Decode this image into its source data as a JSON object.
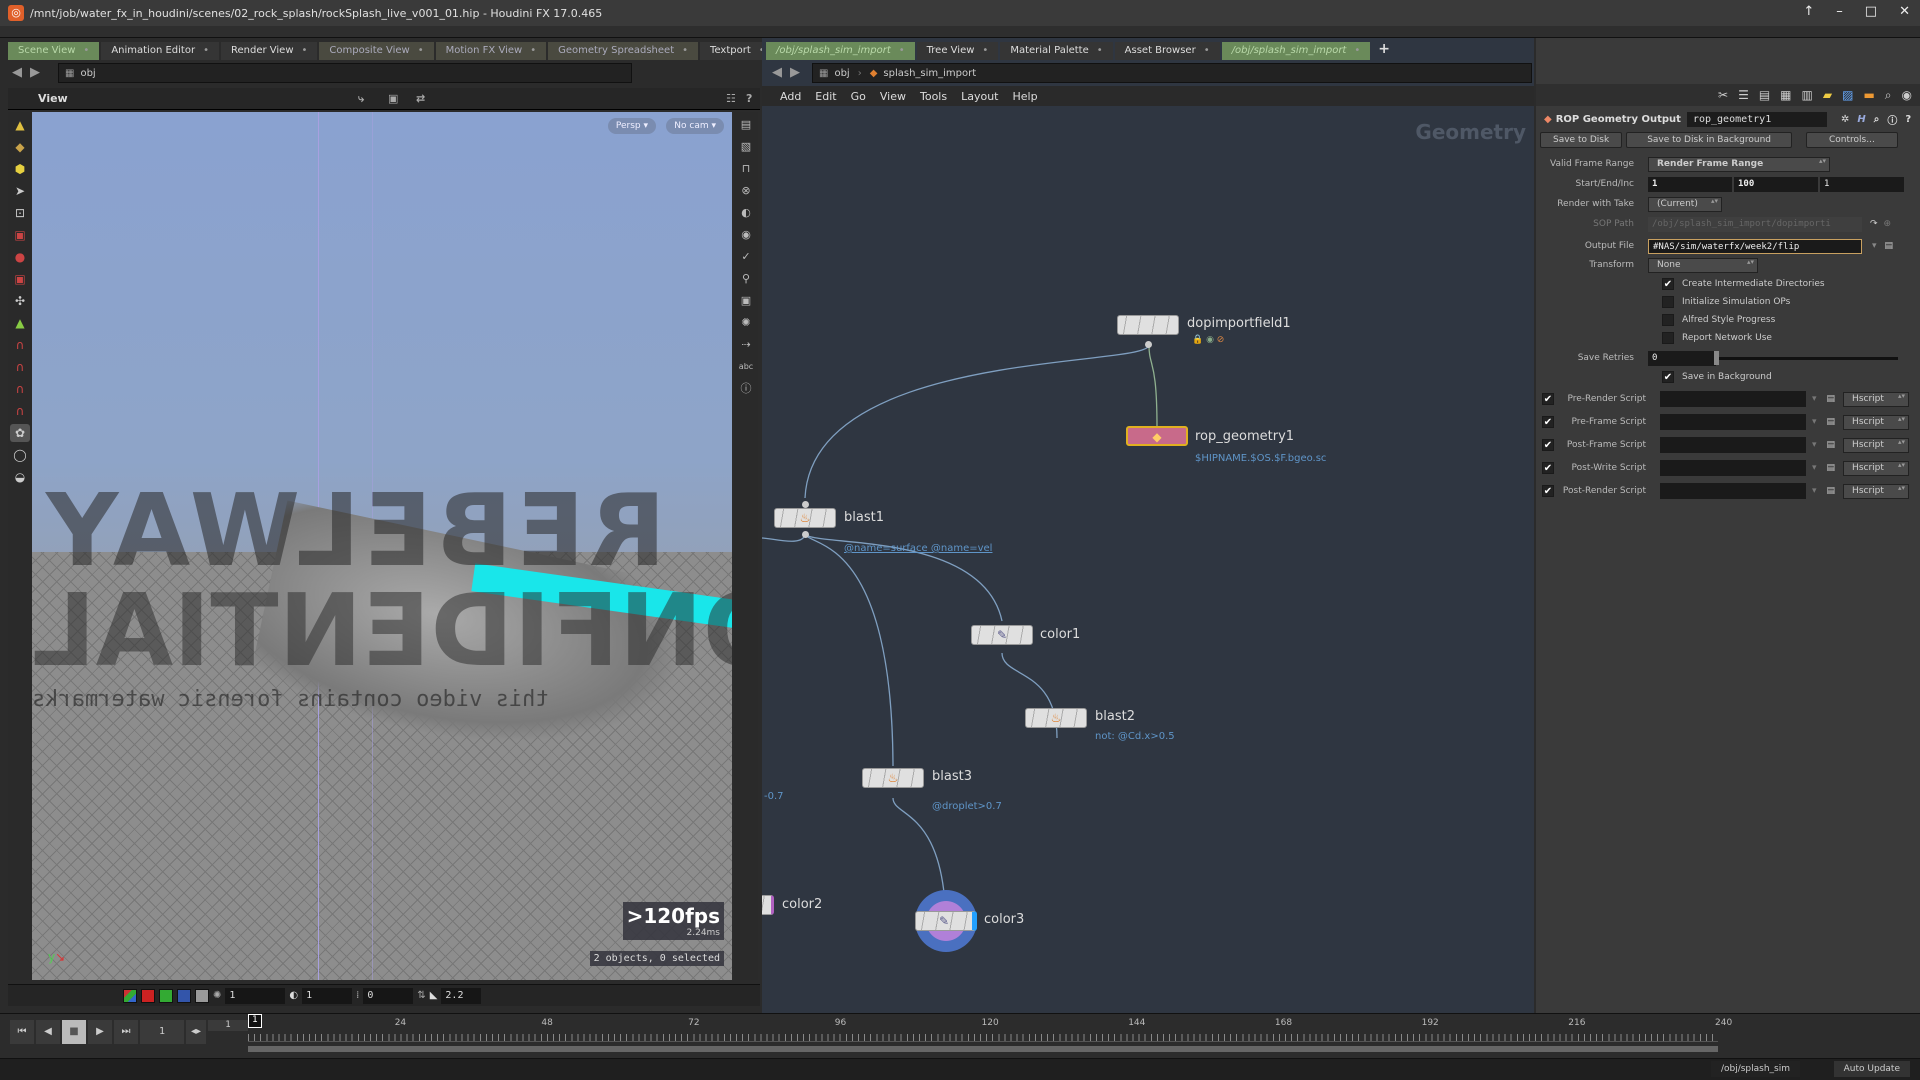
{
  "window": {
    "title": "/mnt/job/water_fx_in_houdini/scenes/02_rock_splash/rockSplash_live_v001_01.hip - Houdini FX 17.0.465",
    "controls": [
      "up-arrow",
      "minimize",
      "maximize",
      "close"
    ]
  },
  "left_pane": {
    "tabs": [
      {
        "label": "Scene View",
        "active": true
      },
      {
        "label": "Animation Editor"
      },
      {
        "label": "Render View"
      },
      {
        "label": "Composite View"
      },
      {
        "label": "Motion FX View"
      },
      {
        "label": "Geometry Spreadsheet"
      },
      {
        "label": "Textport"
      }
    ],
    "path": "obj",
    "view_title": "View",
    "camera_menu": "Persp",
    "cam_menu": "No cam",
    "watermark_line1": "REBELWAY",
    "watermark_line2": "CONFIDENTIAL",
    "watermark_line3": "this video contains forensic watermarks",
    "fps": ">120fps",
    "frame_time": "2.24ms",
    "selection_info": "2 objects, 0 selected",
    "display_bar": {
      "point_size": "1",
      "opacity": "1",
      "offset": "0",
      "gamma": "2.2"
    }
  },
  "network_pane": {
    "tabs": [
      {
        "label": "/obj/splash_sim_import",
        "active": true
      },
      {
        "label": "Tree View"
      },
      {
        "label": "Material Palette"
      },
      {
        "label": "Asset Browser"
      },
      {
        "label": "/obj/splash_sim_import",
        "active": true
      }
    ],
    "breadcrumb": [
      "obj",
      "splash_sim_import"
    ],
    "menu": [
      "Add",
      "Edit",
      "Go",
      "View",
      "Tools",
      "Layout",
      "Help"
    ],
    "context_label": "Geometry",
    "nodes": [
      {
        "name": "dopimportfield1",
        "comment": ""
      },
      {
        "name": "rop_geometry1",
        "comment": "$HIPNAME.$OS.$F.bgeo.sc"
      },
      {
        "name": "blast1",
        "comment": "@name=surface @name=vel"
      },
      {
        "name": "color1",
        "comment": ""
      },
      {
        "name": "blast2",
        "comment": "not: @Cd.x>0.5"
      },
      {
        "name": "blast3",
        "comment": "@droplet>0.7"
      },
      {
        "name": "color2",
        "comment": ""
      },
      {
        "name": "color3",
        "comment": ""
      }
    ],
    "offscreen_comment": "-0.7"
  },
  "params": {
    "node_type": "ROP Geometry Output",
    "node_name": "rop_geometry1",
    "buttons": [
      "Save to Disk",
      "Save to Disk in Background",
      "Controls..."
    ],
    "valid_frame_range": {
      "label": "Valid Frame Range",
      "value": "Render Frame Range"
    },
    "start_end_inc": {
      "label": "Start/End/Inc",
      "start": "1",
      "end": "100",
      "inc": "1"
    },
    "render_with_take": {
      "label": "Render with Take",
      "value": "(Current)"
    },
    "sop_path": {
      "label": "SOP Path",
      "value": "/obj/splash_sim_import/dopimporti"
    },
    "output_file": {
      "label": "Output File",
      "value": "#NAS/sim/waterfx/week2/flip"
    },
    "transform": {
      "label": "Transform",
      "value": "None"
    },
    "toggles": [
      {
        "label": "Create Intermediate Directories",
        "checked": true
      },
      {
        "label": "Initialize Simulation OPs",
        "checked": false
      },
      {
        "label": "Alfred Style Progress",
        "checked": false
      },
      {
        "label": "Report Network Use",
        "checked": false
      }
    ],
    "save_retries": {
      "label": "Save Retries",
      "value": "0"
    },
    "save_in_background": {
      "label": "Save in Background",
      "checked": true
    },
    "scripts": [
      {
        "label": "Pre-Render Script",
        "enabled": true,
        "lang": "Hscript"
      },
      {
        "label": "Pre-Frame Script",
        "enabled": true,
        "lang": "Hscript"
      },
      {
        "label": "Post-Frame Script",
        "enabled": true,
        "lang": "Hscript"
      },
      {
        "label": "Post-Write Script",
        "enabled": true,
        "lang": "Hscript"
      },
      {
        "label": "Post-Render Script",
        "enabled": true,
        "lang": "Hscript"
      }
    ]
  },
  "timeline": {
    "current_frame": "1",
    "start": "1",
    "end": "1",
    "ticks": [
      "1",
      "24",
      "48",
      "72",
      "96",
      "120",
      "144",
      "168",
      "192",
      "216",
      "240"
    ]
  },
  "statusbar": {
    "path": "/obj/splash_sim",
    "update_mode": "Auto Update"
  }
}
